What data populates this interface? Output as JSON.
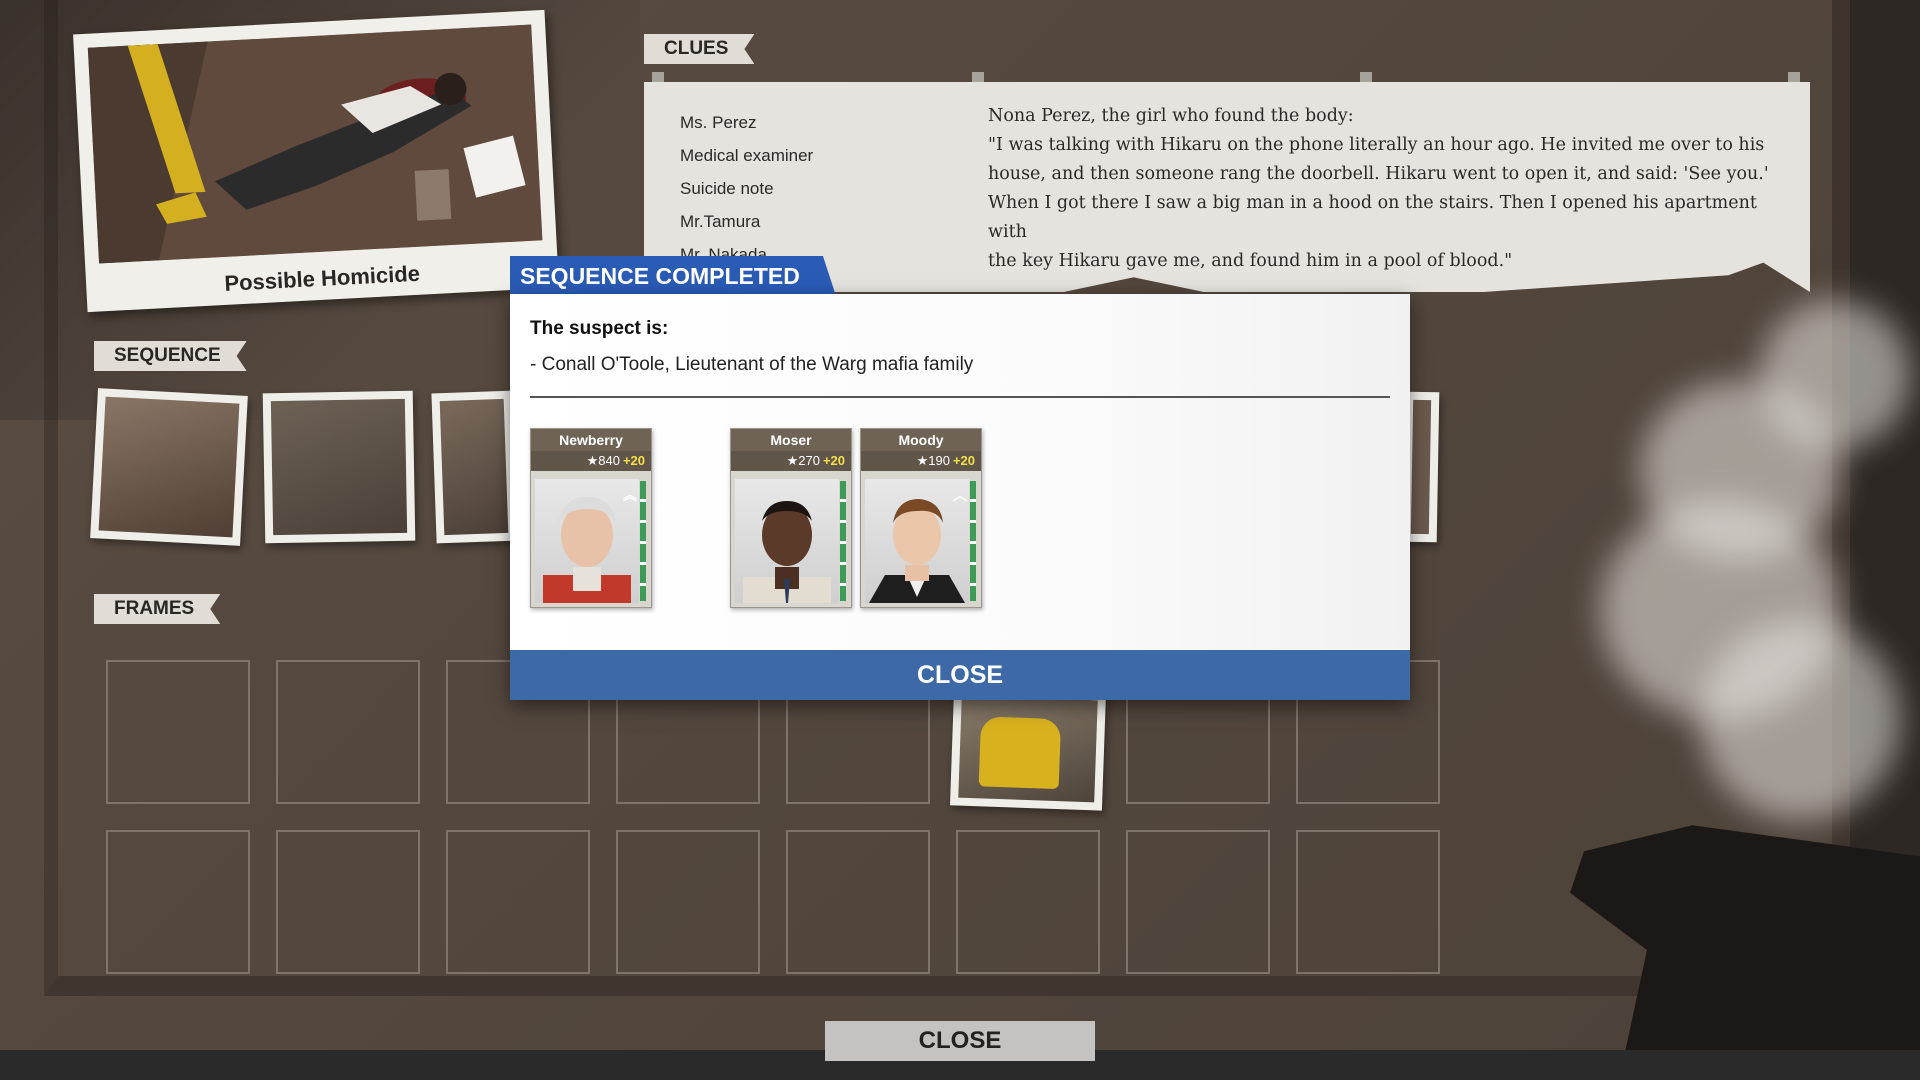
{
  "photo": {
    "caption": "Possible Homicide"
  },
  "clues": {
    "tag": "CLUES",
    "items": [
      "Ms. Perez",
      "Medical examiner",
      "Suicide note",
      "Mr.Tamura",
      "Mr. Nakada"
    ],
    "text_lines": [
      "Nona Perez, the girl who found the body:",
      "\"I was talking with Hikaru on the phone literally an hour ago. He invited me over to his",
      "house, and then someone rang the doorbell. Hikaru went to open it, and said: 'See you.'",
      "When I got there I saw a big man in a hood on the stairs. Then I opened his apartment with",
      "the key Hikaru gave me, and found him in a pool of blood.\""
    ]
  },
  "sequence": {
    "tag": "SEQUENCE"
  },
  "frames": {
    "tag": "FRAMES"
  },
  "modal": {
    "header": "SEQUENCE COMPLETED",
    "suspect_label": "The suspect is:",
    "suspect_name": "- Conall O'Toole, Lieutenant of the Warg mafia family",
    "close_label": "CLOSE",
    "cards": [
      {
        "name": "Newberry",
        "rating": "840",
        "bonus": "+20",
        "rank_icon": "double-chevron-icon"
      },
      {
        "name": "Moser",
        "rating": "270",
        "bonus": "+20",
        "rank_icon": ""
      },
      {
        "name": "Moody",
        "rating": "190",
        "bonus": "+20",
        "rank_icon": "chevron-icon"
      }
    ]
  },
  "footer": {
    "close_label": "CLOSE"
  },
  "colors": {
    "modal_header": "#2a5bb5",
    "modal_close": "#3d6aa6",
    "bonus": "#f5e04a",
    "board": "#54483e"
  }
}
